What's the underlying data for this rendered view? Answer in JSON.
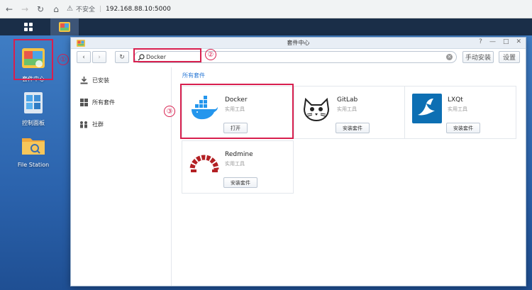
{
  "browser": {
    "security_label": "不安全",
    "url": "192.168.88.10:5000"
  },
  "desktop": {
    "icons": [
      {
        "label": "套件中心"
      },
      {
        "label": "控制面板"
      },
      {
        "label": "File Station"
      }
    ]
  },
  "annotations": {
    "one": "①",
    "two": "②",
    "three": "③"
  },
  "window": {
    "title": "套件中心",
    "toolbar": {
      "back": "‹",
      "forward": "›",
      "refresh": "↻",
      "search_value": "Docker",
      "manual_install": "手动安装",
      "settings": "设置"
    },
    "sidebar": [
      {
        "label": "已安装",
        "icon": "download-icon"
      },
      {
        "label": "所有套件",
        "icon": "grid-icon"
      },
      {
        "label": "社群",
        "icon": "community-icon"
      }
    ],
    "section_title": "所有套件",
    "packages": [
      {
        "name": "Docker",
        "category": "实用工具",
        "action": "打开",
        "icon": "docker-whale-icon"
      },
      {
        "name": "GitLab",
        "category": "实用工具",
        "action": "安装套件",
        "icon": "gitlab-cat-icon"
      },
      {
        "name": "LXQt",
        "category": "实用工具",
        "action": "安装套件",
        "icon": "lxqt-bird-icon"
      },
      {
        "name": "Redmine",
        "category": "实用工具",
        "action": "安装套件",
        "icon": "redmine-icon"
      }
    ]
  },
  "colors": {
    "accent": "#2b7ad6",
    "highlight": "#d81f4e",
    "desktop_bg": "#3f7dc4",
    "taskbar": "#1a2e48"
  }
}
